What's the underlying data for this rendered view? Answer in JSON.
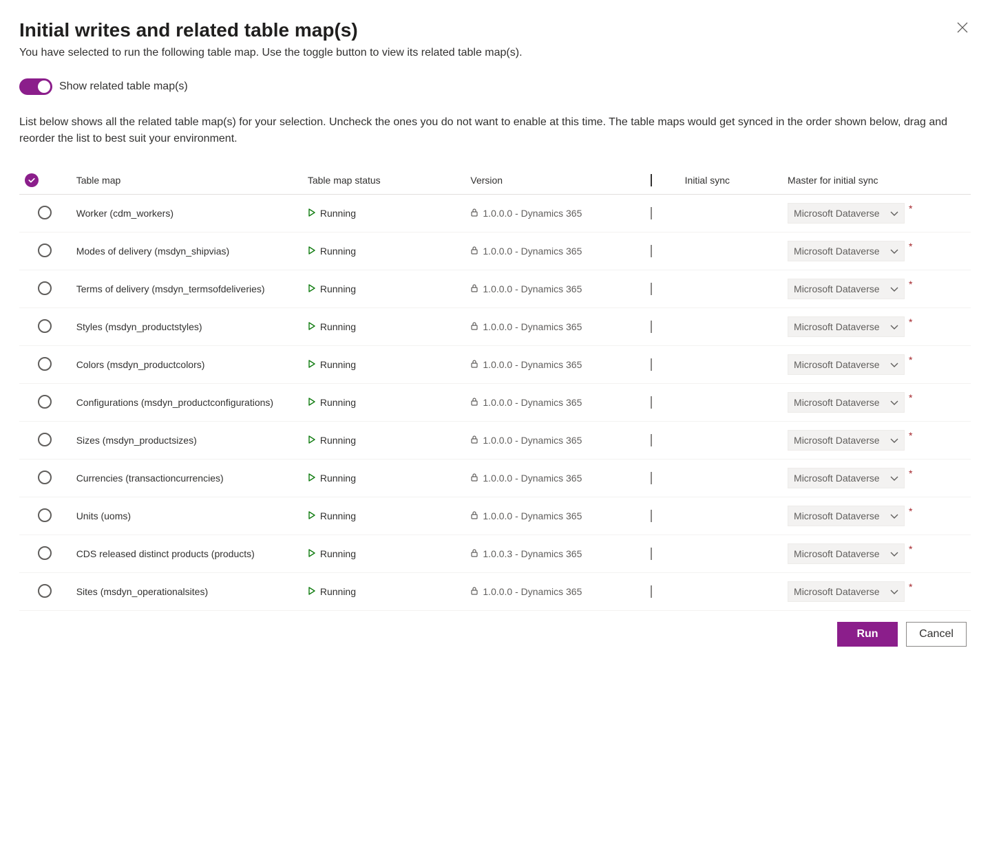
{
  "header": {
    "title": "Initial writes and related table map(s)",
    "subtitle": "You have selected to run the following table map. Use the toggle button to view its related table map(s)."
  },
  "toggle": {
    "label": "Show related table map(s)"
  },
  "description": "List below shows all the related table map(s) for your selection. Uncheck the ones you do not want to enable at this time. The table maps would get synced in the order shown below, drag and reorder the list to best suit your environment.",
  "columns": {
    "table_map": "Table map",
    "status": "Table map status",
    "version": "Version",
    "initial_sync": "Initial sync",
    "master": "Master for initial sync"
  },
  "master_default": "Microsoft Dataverse",
  "rows": [
    {
      "name": "Worker (cdm_workers)",
      "status": "Running",
      "version": "1.0.0.0 - Dynamics 365"
    },
    {
      "name": "Modes of delivery (msdyn_shipvias)",
      "status": "Running",
      "version": "1.0.0.0 - Dynamics 365"
    },
    {
      "name": "Terms of delivery (msdyn_termsofdeliveries)",
      "status": "Running",
      "version": "1.0.0.0 - Dynamics 365"
    },
    {
      "name": "Styles (msdyn_productstyles)",
      "status": "Running",
      "version": "1.0.0.0 - Dynamics 365"
    },
    {
      "name": "Colors (msdyn_productcolors)",
      "status": "Running",
      "version": "1.0.0.0 - Dynamics 365"
    },
    {
      "name": "Configurations (msdyn_productconfigurations)",
      "status": "Running",
      "version": "1.0.0.0 - Dynamics 365"
    },
    {
      "name": "Sizes (msdyn_productsizes)",
      "status": "Running",
      "version": "1.0.0.0 - Dynamics 365"
    },
    {
      "name": "Currencies (transactioncurrencies)",
      "status": "Running",
      "version": "1.0.0.0 - Dynamics 365"
    },
    {
      "name": "Units (uoms)",
      "status": "Running",
      "version": "1.0.0.0 - Dynamics 365"
    },
    {
      "name": "CDS released distinct products (products)",
      "status": "Running",
      "version": "1.0.0.3 - Dynamics 365"
    },
    {
      "name": "Sites (msdyn_operationalsites)",
      "status": "Running",
      "version": "1.0.0.0 - Dynamics 365"
    }
  ],
  "footer": {
    "run": "Run",
    "cancel": "Cancel"
  }
}
